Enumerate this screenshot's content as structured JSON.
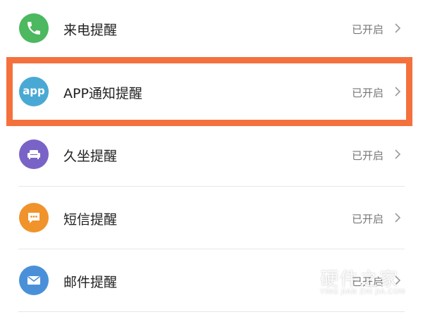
{
  "items": [
    {
      "label": "来电提醒",
      "status": "已开启",
      "icon": "phone-icon",
      "icon_color": "#4cb85f"
    },
    {
      "label": "APP通知提醒",
      "status": "已开启",
      "icon": "app-icon",
      "icon_text": "app",
      "icon_color": "#4aa9d4"
    },
    {
      "label": "久坐提醒",
      "status": "已开启",
      "icon": "sofa-icon",
      "icon_color": "#7a63c6"
    },
    {
      "label": "短信提醒",
      "status": "已开启",
      "icon": "message-icon",
      "icon_color": "#f0932b"
    },
    {
      "label": "邮件提醒",
      "status": "已开启",
      "icon": "mail-icon",
      "icon_color": "#4a90d9"
    }
  ],
  "highlight_color": "#f4713d",
  "watermark": {
    "name": "硬件之家",
    "subtitle": "YING JIAN ZHI JIA.COM"
  }
}
